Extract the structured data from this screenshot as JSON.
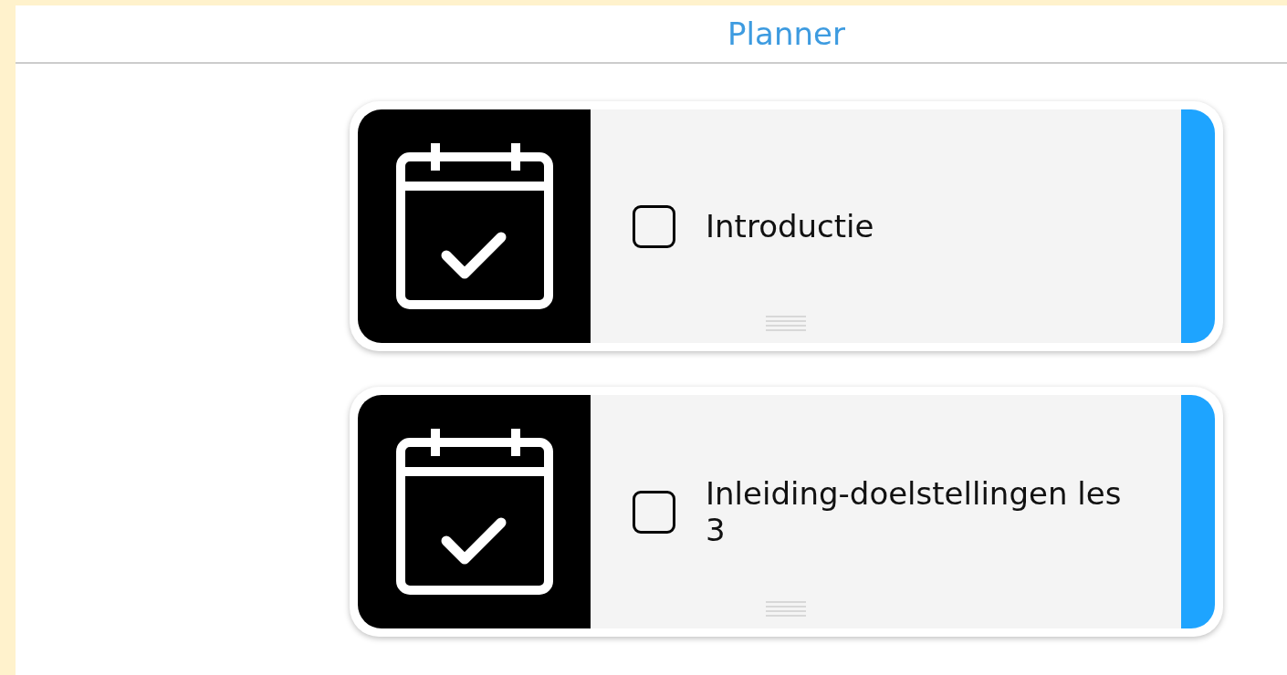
{
  "header": {
    "title": "Planner"
  },
  "items": [
    {
      "title": "Introductie",
      "checked": false
    },
    {
      "title": "Inleiding-doelstellingen les 3",
      "checked": false
    }
  ]
}
